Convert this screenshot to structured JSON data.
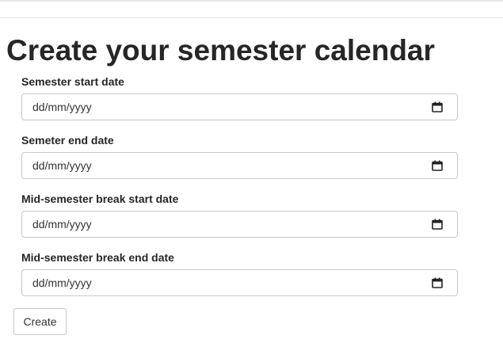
{
  "page": {
    "title": "Create your semester calendar"
  },
  "form": {
    "fields": [
      {
        "label": "Semester start date",
        "placeholder": "dd/mm/yyyy"
      },
      {
        "label": "Semeter end date",
        "placeholder": "dd/mm/yyyy"
      },
      {
        "label": "Mid-semester break start date",
        "placeholder": "dd/mm/yyyy"
      },
      {
        "label": "Mid-semester break end date",
        "placeholder": "dd/mm/yyyy"
      }
    ],
    "submit_label": "Create"
  },
  "icons": {
    "date_picker": "calendar-icon"
  }
}
